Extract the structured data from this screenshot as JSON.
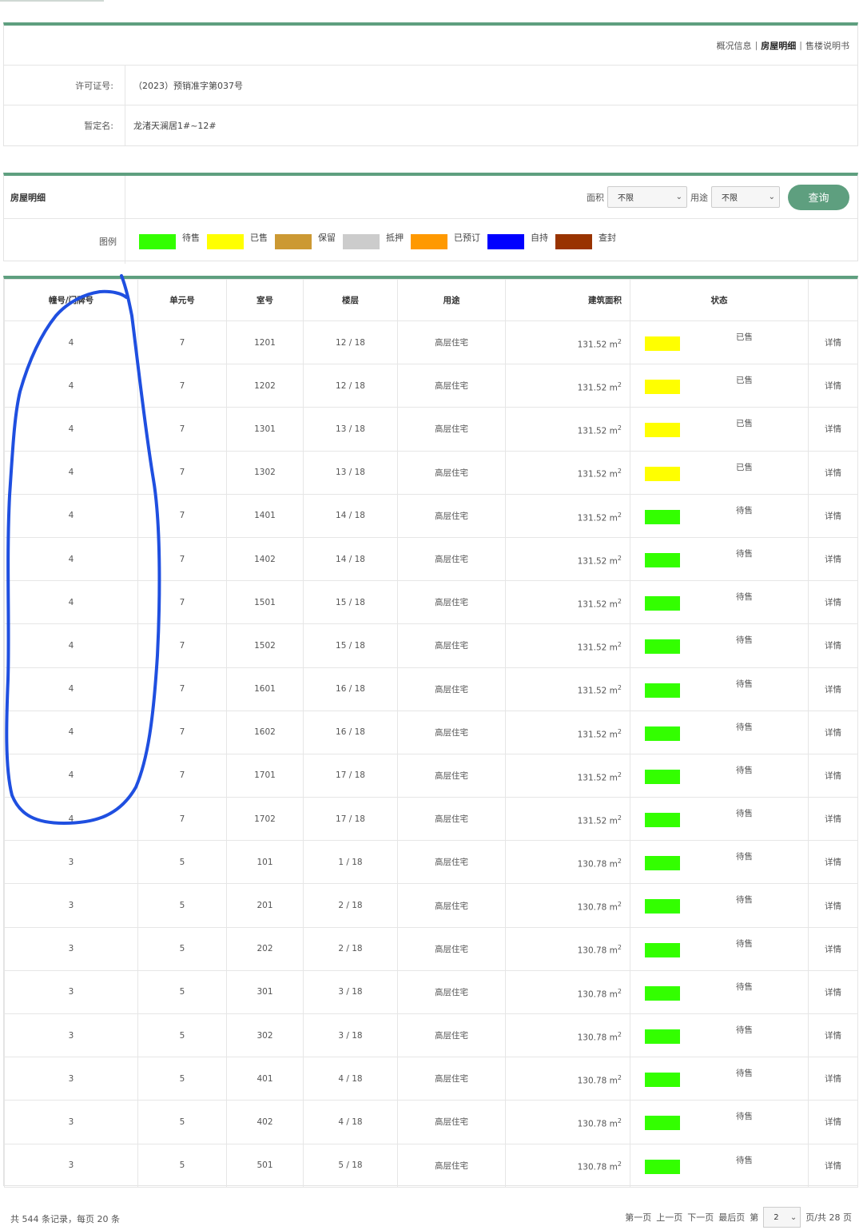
{
  "nav": {
    "items": [
      {
        "label": "概况信息",
        "active": false
      },
      {
        "label": "房屋明细",
        "active": true
      },
      {
        "label": "售楼说明书",
        "active": false
      }
    ],
    "separator": "|"
  },
  "info": {
    "permit_label": "许可证号:",
    "permit_value": "（2023）预销准字第037号",
    "name_label": "暂定名:",
    "name_value": "龙渚天澜居1#~12#"
  },
  "filter": {
    "section_title": "房屋明细",
    "area_label": "面积",
    "area_value": "不限",
    "usage_label": "用途",
    "usage_value": "不限",
    "query_label": "查询"
  },
  "legend": {
    "label": "图例",
    "items": [
      {
        "name": "待售",
        "color": "#33ff00"
      },
      {
        "name": "已售",
        "color": "#ffff00"
      },
      {
        "name": "保留",
        "color": "#cc9933"
      },
      {
        "name": "抵押",
        "color": "#cccccc"
      },
      {
        "name": "已预订",
        "color": "#ff9900"
      },
      {
        "name": "自持",
        "color": "#0000ff"
      },
      {
        "name": "查封",
        "color": "#993300"
      }
    ]
  },
  "table": {
    "headers": [
      "幢号/门牌号",
      "单元号",
      "室号",
      "楼层",
      "用途",
      "建筑面积",
      "状态",
      ""
    ],
    "area_unit": "m",
    "area_unit_sup": "2",
    "detail_label": "详情",
    "rows": [
      {
        "building": "4",
        "unit": "7",
        "room": "1201",
        "floor": "12 / 18",
        "usage": "高层住宅",
        "area": "131.52",
        "status": "已售",
        "status_color": "#ffff00"
      },
      {
        "building": "4",
        "unit": "7",
        "room": "1202",
        "floor": "12 / 18",
        "usage": "高层住宅",
        "area": "131.52",
        "status": "已售",
        "status_color": "#ffff00"
      },
      {
        "building": "4",
        "unit": "7",
        "room": "1301",
        "floor": "13 / 18",
        "usage": "高层住宅",
        "area": "131.52",
        "status": "已售",
        "status_color": "#ffff00"
      },
      {
        "building": "4",
        "unit": "7",
        "room": "1302",
        "floor": "13 / 18",
        "usage": "高层住宅",
        "area": "131.52",
        "status": "已售",
        "status_color": "#ffff00"
      },
      {
        "building": "4",
        "unit": "7",
        "room": "1401",
        "floor": "14 / 18",
        "usage": "高层住宅",
        "area": "131.52",
        "status": "待售",
        "status_color": "#33ff00"
      },
      {
        "building": "4",
        "unit": "7",
        "room": "1402",
        "floor": "14 / 18",
        "usage": "高层住宅",
        "area": "131.52",
        "status": "待售",
        "status_color": "#33ff00"
      },
      {
        "building": "4",
        "unit": "7",
        "room": "1501",
        "floor": "15 / 18",
        "usage": "高层住宅",
        "area": "131.52",
        "status": "待售",
        "status_color": "#33ff00"
      },
      {
        "building": "4",
        "unit": "7",
        "room": "1502",
        "floor": "15 / 18",
        "usage": "高层住宅",
        "area": "131.52",
        "status": "待售",
        "status_color": "#33ff00"
      },
      {
        "building": "4",
        "unit": "7",
        "room": "1601",
        "floor": "16 / 18",
        "usage": "高层住宅",
        "area": "131.52",
        "status": "待售",
        "status_color": "#33ff00"
      },
      {
        "building": "4",
        "unit": "7",
        "room": "1602",
        "floor": "16 / 18",
        "usage": "高层住宅",
        "area": "131.52",
        "status": "待售",
        "status_color": "#33ff00"
      },
      {
        "building": "4",
        "unit": "7",
        "room": "1701",
        "floor": "17 / 18",
        "usage": "高层住宅",
        "area": "131.52",
        "status": "待售",
        "status_color": "#33ff00"
      },
      {
        "building": "4",
        "unit": "7",
        "room": "1702",
        "floor": "17 / 18",
        "usage": "高层住宅",
        "area": "131.52",
        "status": "待售",
        "status_color": "#33ff00"
      },
      {
        "building": "3",
        "unit": "5",
        "room": "101",
        "floor": "1 / 18",
        "usage": "高层住宅",
        "area": "130.78",
        "status": "待售",
        "status_color": "#33ff00"
      },
      {
        "building": "3",
        "unit": "5",
        "room": "201",
        "floor": "2 / 18",
        "usage": "高层住宅",
        "area": "130.78",
        "status": "待售",
        "status_color": "#33ff00"
      },
      {
        "building": "3",
        "unit": "5",
        "room": "202",
        "floor": "2 / 18",
        "usage": "高层住宅",
        "area": "130.78",
        "status": "待售",
        "status_color": "#33ff00"
      },
      {
        "building": "3",
        "unit": "5",
        "room": "301",
        "floor": "3 / 18",
        "usage": "高层住宅",
        "area": "130.78",
        "status": "待售",
        "status_color": "#33ff00"
      },
      {
        "building": "3",
        "unit": "5",
        "room": "302",
        "floor": "3 / 18",
        "usage": "高层住宅",
        "area": "130.78",
        "status": "待售",
        "status_color": "#33ff00"
      },
      {
        "building": "3",
        "unit": "5",
        "room": "401",
        "floor": "4 / 18",
        "usage": "高层住宅",
        "area": "130.78",
        "status": "待售",
        "status_color": "#33ff00"
      },
      {
        "building": "3",
        "unit": "5",
        "room": "402",
        "floor": "4 / 18",
        "usage": "高层住宅",
        "area": "130.78",
        "status": "待售",
        "status_color": "#33ff00"
      },
      {
        "building": "3",
        "unit": "5",
        "room": "501",
        "floor": "5 / 18",
        "usage": "高层住宅",
        "area": "130.78",
        "status": "待售",
        "status_color": "#33ff00"
      }
    ]
  },
  "pager": {
    "summary": "共 544 条记录，每页 20 条",
    "first": "第一页",
    "prev": "上一页",
    "next": "下一页",
    "last": "最后页",
    "page_prefix": "第",
    "current_page": "2",
    "page_suffix": "页/共 28 页"
  },
  "annotation": {
    "color": "#1f4fe0"
  }
}
